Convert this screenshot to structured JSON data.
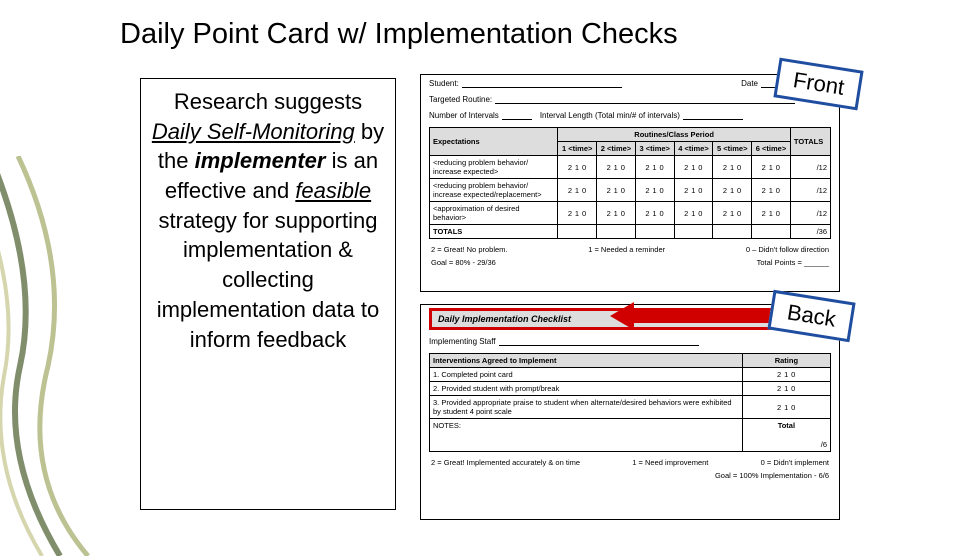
{
  "title": "Daily Point Card w/ Implementation Checks",
  "textbox": {
    "t1": "Research suggests ",
    "t2": "Daily Self-Monitoring",
    "t3": " by the ",
    "t4": "implementer",
    "t5": " is an effective and ",
    "t6": "feasible",
    "t7": " strategy for supporting implementation & collecting implementation data to inform feedback"
  },
  "callouts": {
    "front": "Front",
    "back": "Back"
  },
  "front": {
    "student_label": "Student:",
    "date_label": "Date",
    "targeted_label": "Targeted Routine:",
    "num_intervals_label": "Number of Intervals",
    "interval_len_label": "Interval Length (Total min/# of intervals)",
    "routines_header": "Routines/Class Period",
    "expectations_header": "Expectations",
    "time_cols": [
      "1 <time>",
      "2 <time>",
      "3 <time>",
      "4 <time>",
      "5 <time>",
      "6 <time>"
    ],
    "totals_col": "TOTALS",
    "rows": [
      {
        "label": "<reducing problem behavior/ increase expected>",
        "scores": [
          "2 1 0",
          "2 1 0",
          "2 1 0",
          "2 1 0",
          "2 1 0",
          "2 1 0"
        ],
        "total": "/12"
      },
      {
        "label": "<reducing problem behavior/ increase expected/replacement>",
        "scores": [
          "2 1 0",
          "2 1 0",
          "2 1 0",
          "2 1 0",
          "2 1 0",
          "2 1 0"
        ],
        "total": "/12"
      },
      {
        "label": "<approximation of desired behavior>",
        "scores": [
          "2 1 0",
          "2 1 0",
          "2 1 0",
          "2 1 0",
          "2 1 0",
          "2 1 0"
        ],
        "total": "/12"
      },
      {
        "label": "TOTALS",
        "scores": [
          "",
          "",
          "",
          "",
          "",
          ""
        ],
        "total": "/36"
      }
    ],
    "legend_left": "2 = Great! No problem.",
    "legend_mid": "1 = Needed a reminder",
    "legend_right": "0 – Didn't follow direction",
    "goal": "Goal = 80% - 29/36",
    "total_points": "Total Points = ______"
  },
  "back": {
    "checklist_title": "Daily Implementation Checklist",
    "staff_label": "Implementing Staff",
    "intv_header": "Interventions Agreed to Implement",
    "rating_header": "Rating",
    "rows": [
      {
        "n": "1.",
        "label": "Completed point card",
        "rating": "2 1 0"
      },
      {
        "n": "2.",
        "label": "Provided student with prompt/break",
        "rating": "2 1 0"
      },
      {
        "n": "3.",
        "label": "Provided appropriate praise to student when alternate/desired behaviors were exhibited by student 4 point scale",
        "rating": "2 1 0"
      }
    ],
    "notes_label": "NOTES:",
    "total_label": "Total",
    "total_value": "/6",
    "legend_left": "2 = Great! Implemented accurately & on time",
    "legend_mid": "1 = Need improvement",
    "legend_right": "0 = Didn't implement",
    "goal": "Goal = 100% Implementation - 6/6"
  }
}
